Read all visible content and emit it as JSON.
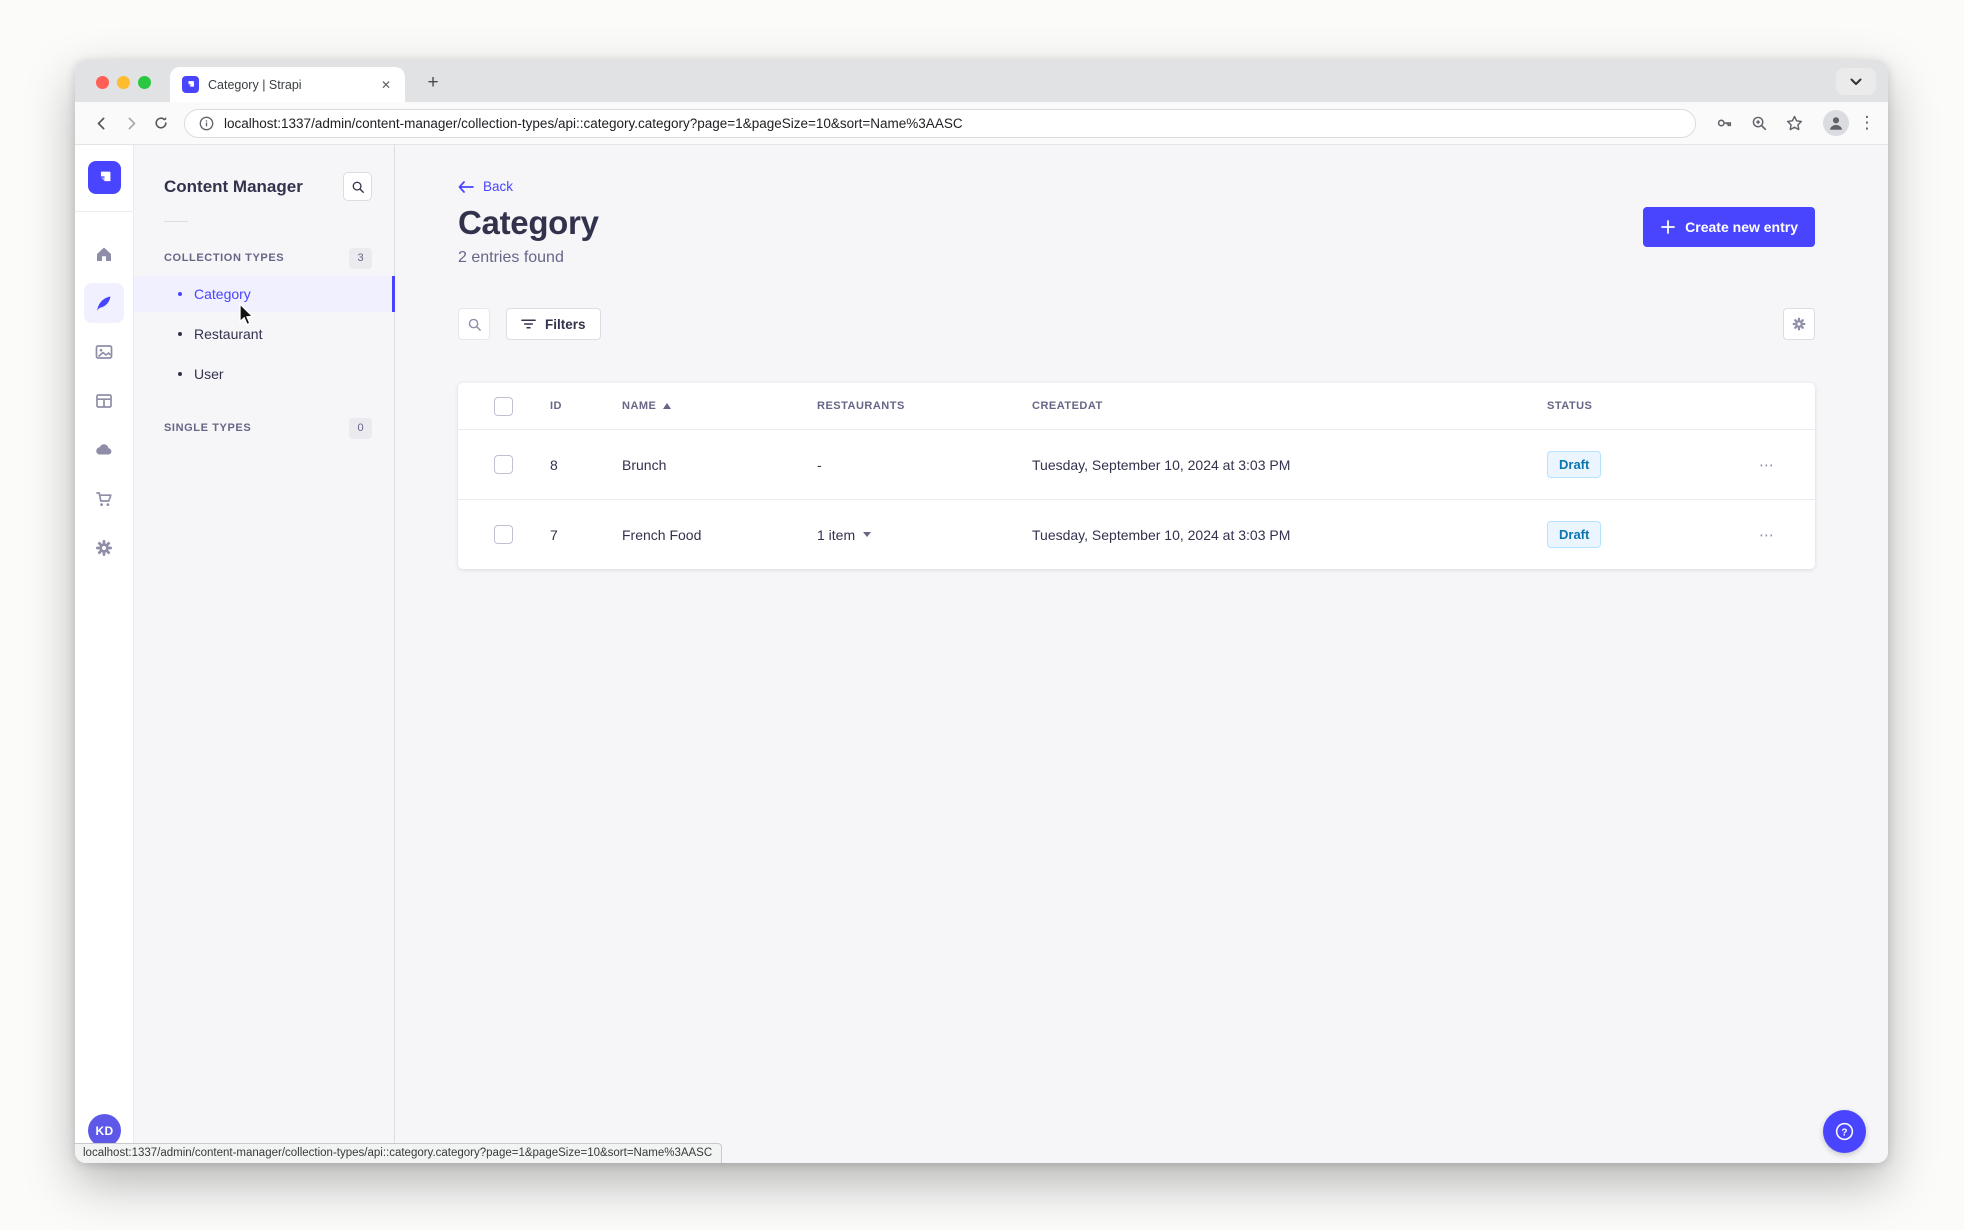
{
  "browser": {
    "tab_title": "Category | Strapi",
    "url": "localhost:1337/admin/content-manager/collection-types/api::category.category?page=1&pageSize=10&sort=Name%3AASC",
    "status_bar_url": "localhost:1337/admin/content-manager/collection-types/api::category.category?page=1&pageSize=10&sort=Name%3AASC"
  },
  "icons": {
    "tab_close": "✕",
    "new_tab": "+",
    "toolbar_menu_dots": "⋮",
    "row_actions_dots": "⋯"
  },
  "nav_rail": {
    "avatar_initials": "KD",
    "items": [
      {
        "name": "home"
      },
      {
        "name": "content-manager",
        "active": true
      },
      {
        "name": "media-library"
      },
      {
        "name": "content-type-builder"
      },
      {
        "name": "cloud"
      },
      {
        "name": "marketplace"
      },
      {
        "name": "settings"
      }
    ]
  },
  "subnav": {
    "title": "Content Manager",
    "collection_section": {
      "label": "COLLECTION TYPES",
      "count": "3",
      "items": [
        {
          "label": "Category",
          "active": true
        },
        {
          "label": "Restaurant",
          "active": false
        },
        {
          "label": "User",
          "active": false
        }
      ]
    },
    "single_section": {
      "label": "SINGLE TYPES",
      "count": "0"
    }
  },
  "main": {
    "back_label": "Back",
    "title": "Category",
    "subtitle": "2 entries found",
    "create_button_label": "Create new entry",
    "filters_label": "Filters"
  },
  "table": {
    "headers": {
      "id": "ID",
      "name": "NAME",
      "restaurants": "RESTAURANTS",
      "createdat": "CREATEDAT",
      "status": "STATUS"
    },
    "sort": {
      "column": "NAME",
      "direction": "asc"
    },
    "rows": [
      {
        "id": "8",
        "name": "Brunch",
        "restaurants": "-",
        "createdat": "Tuesday, September 10, 2024 at 3:03 PM",
        "status": "Draft"
      },
      {
        "id": "7",
        "name": "French Food",
        "restaurants": "1 item",
        "createdat": "Tuesday, September 10, 2024 at 3:03 PM",
        "status": "Draft"
      }
    ]
  },
  "colors": {
    "primary": "#4945ff",
    "active_item_bg": "#f0f0ff",
    "status_draft_bg": "#eaf5ff",
    "status_draft_border": "#b8e1ff",
    "status_draft_text": "#0c75af",
    "app_bg": "#f6f6f9"
  }
}
